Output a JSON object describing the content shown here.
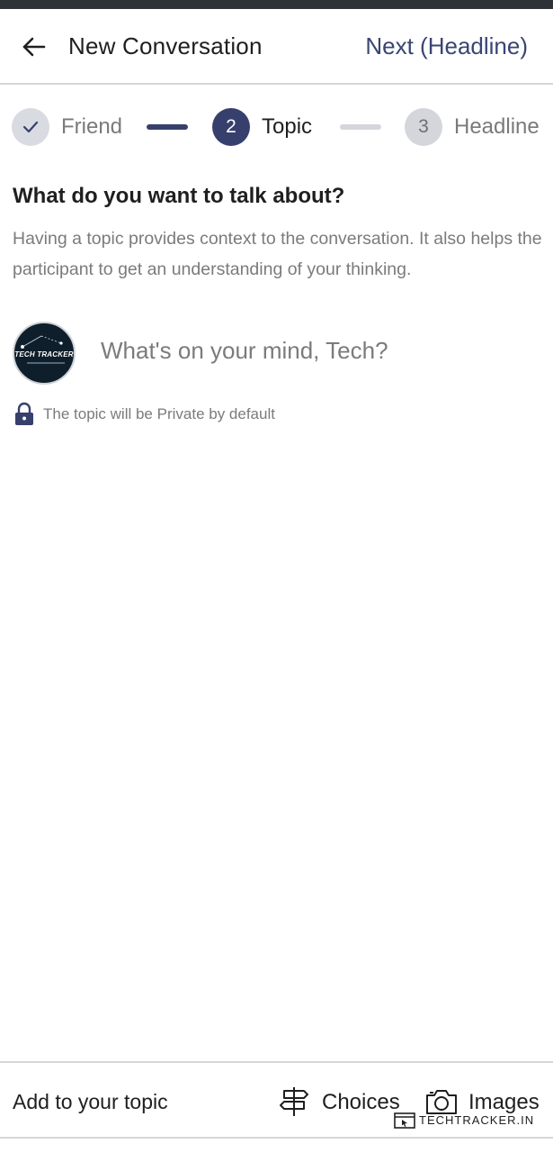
{
  "header": {
    "title": "New Conversation",
    "next_label": "Next (Headline)"
  },
  "stepper": {
    "steps": [
      {
        "number": "",
        "label": "Friend",
        "state": "done"
      },
      {
        "number": "2",
        "label": "Topic",
        "state": "active"
      },
      {
        "number": "3",
        "label": "Headline",
        "state": "upcoming"
      }
    ]
  },
  "content": {
    "question": "What do you want to talk about?",
    "description": "Having a topic provides context to the conversation. It also helps the participant to get an understanding of your thinking.",
    "avatar_text": "TECH TRACKER",
    "input_placeholder": "What's on your mind, Tech?",
    "privacy_note": "The topic will be Private by default"
  },
  "bottom_bar": {
    "add_label": "Add to your topic",
    "choices_label": "Choices",
    "images_label": "Images"
  },
  "watermark": {
    "text": "TECHTRACKER.IN"
  },
  "colors": {
    "accent": "#37406c",
    "link": "#3a4573",
    "muted_text": "#7b7b7b",
    "inactive": "#d4d6dc",
    "status_bar": "#2f3138"
  },
  "icons": [
    "back-arrow-icon",
    "check-icon",
    "lock-icon",
    "signpost-icon",
    "camera-icon"
  ]
}
